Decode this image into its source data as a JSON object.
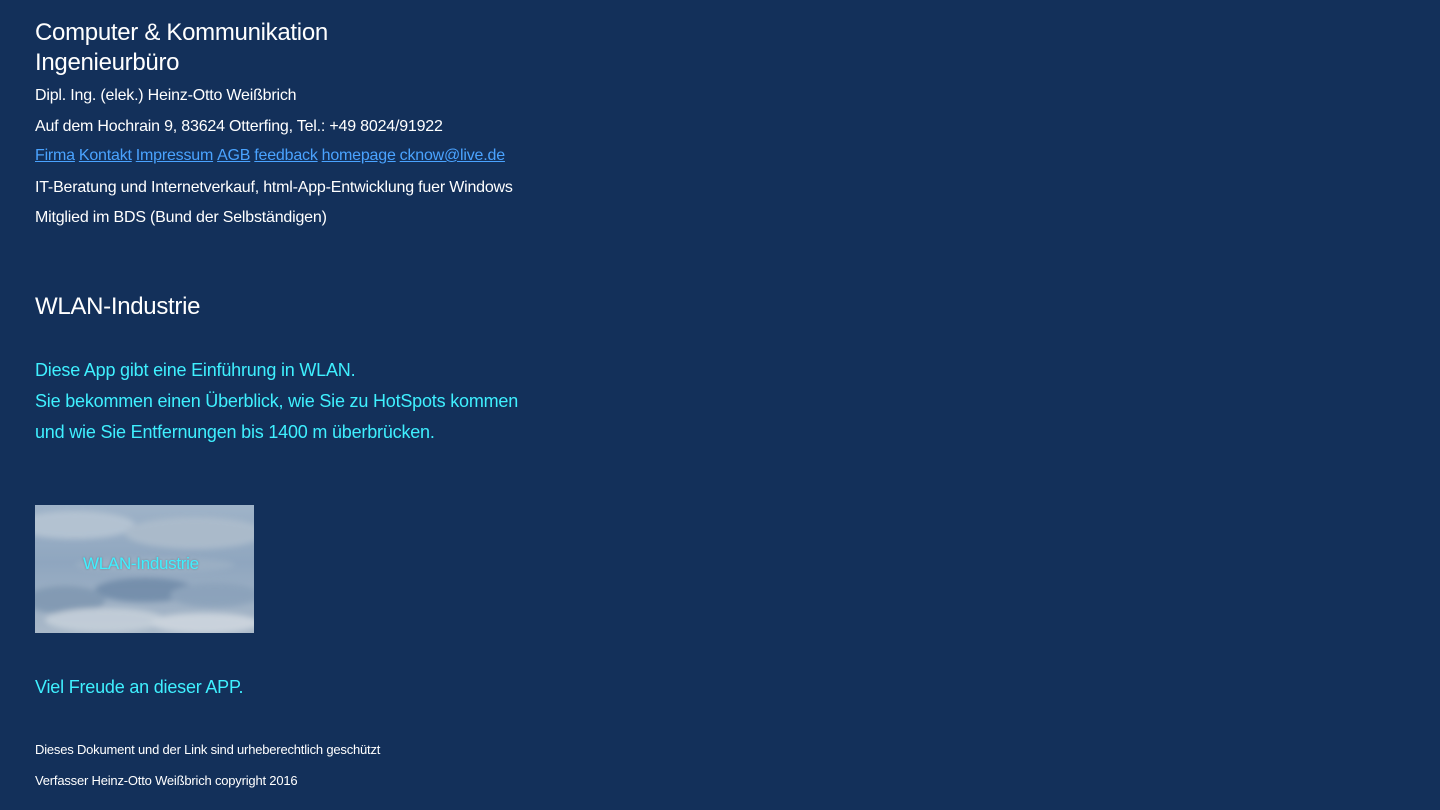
{
  "header": {
    "company_line1": "Computer & Kommunikation",
    "company_line2": "Ingenieurbüro",
    "person": "Dipl. Ing. (elek.) Heinz-Otto Weißbrich",
    "address": "Auf dem Hochrain 9, 83624 Otterfing,   Tel.: +49 8024/91922"
  },
  "nav": {
    "links": [
      {
        "label": "Firma"
      },
      {
        "label": "Kontakt"
      },
      {
        "label": "Impressum"
      },
      {
        "label": "AGB"
      },
      {
        "label": "feedback"
      },
      {
        "label": "homepage"
      },
      {
        "label": "cknow@live.de"
      }
    ]
  },
  "info": {
    "line1": "IT-Beratung und Internetverkauf, html-App-Entwicklung fuer Windows",
    "line2": "Mitglied im BDS (Bund der Selbständigen)"
  },
  "main": {
    "title": "WLAN-Industrie",
    "intro1": "Diese App gibt eine Einführung in WLAN.",
    "intro2": "Sie bekommen einen Überblick, wie Sie zu HotSpots kommen",
    "intro3": "und wie Sie Entfernungen bis 1400 m überbrücken.",
    "image_label": "WLAN-Industrie",
    "closing": "Viel Freude an dieser  APP."
  },
  "footer": {
    "line1": "Dieses Dokument und der Link  sind urheberechtlich geschützt",
    "line2": "Verfasser Heinz-Otto Weißbrich copyright 2016"
  },
  "colors": {
    "background": "#13305a",
    "link": "#4aa3ff",
    "accent": "#3ff0ff",
    "text": "#ffffff"
  }
}
